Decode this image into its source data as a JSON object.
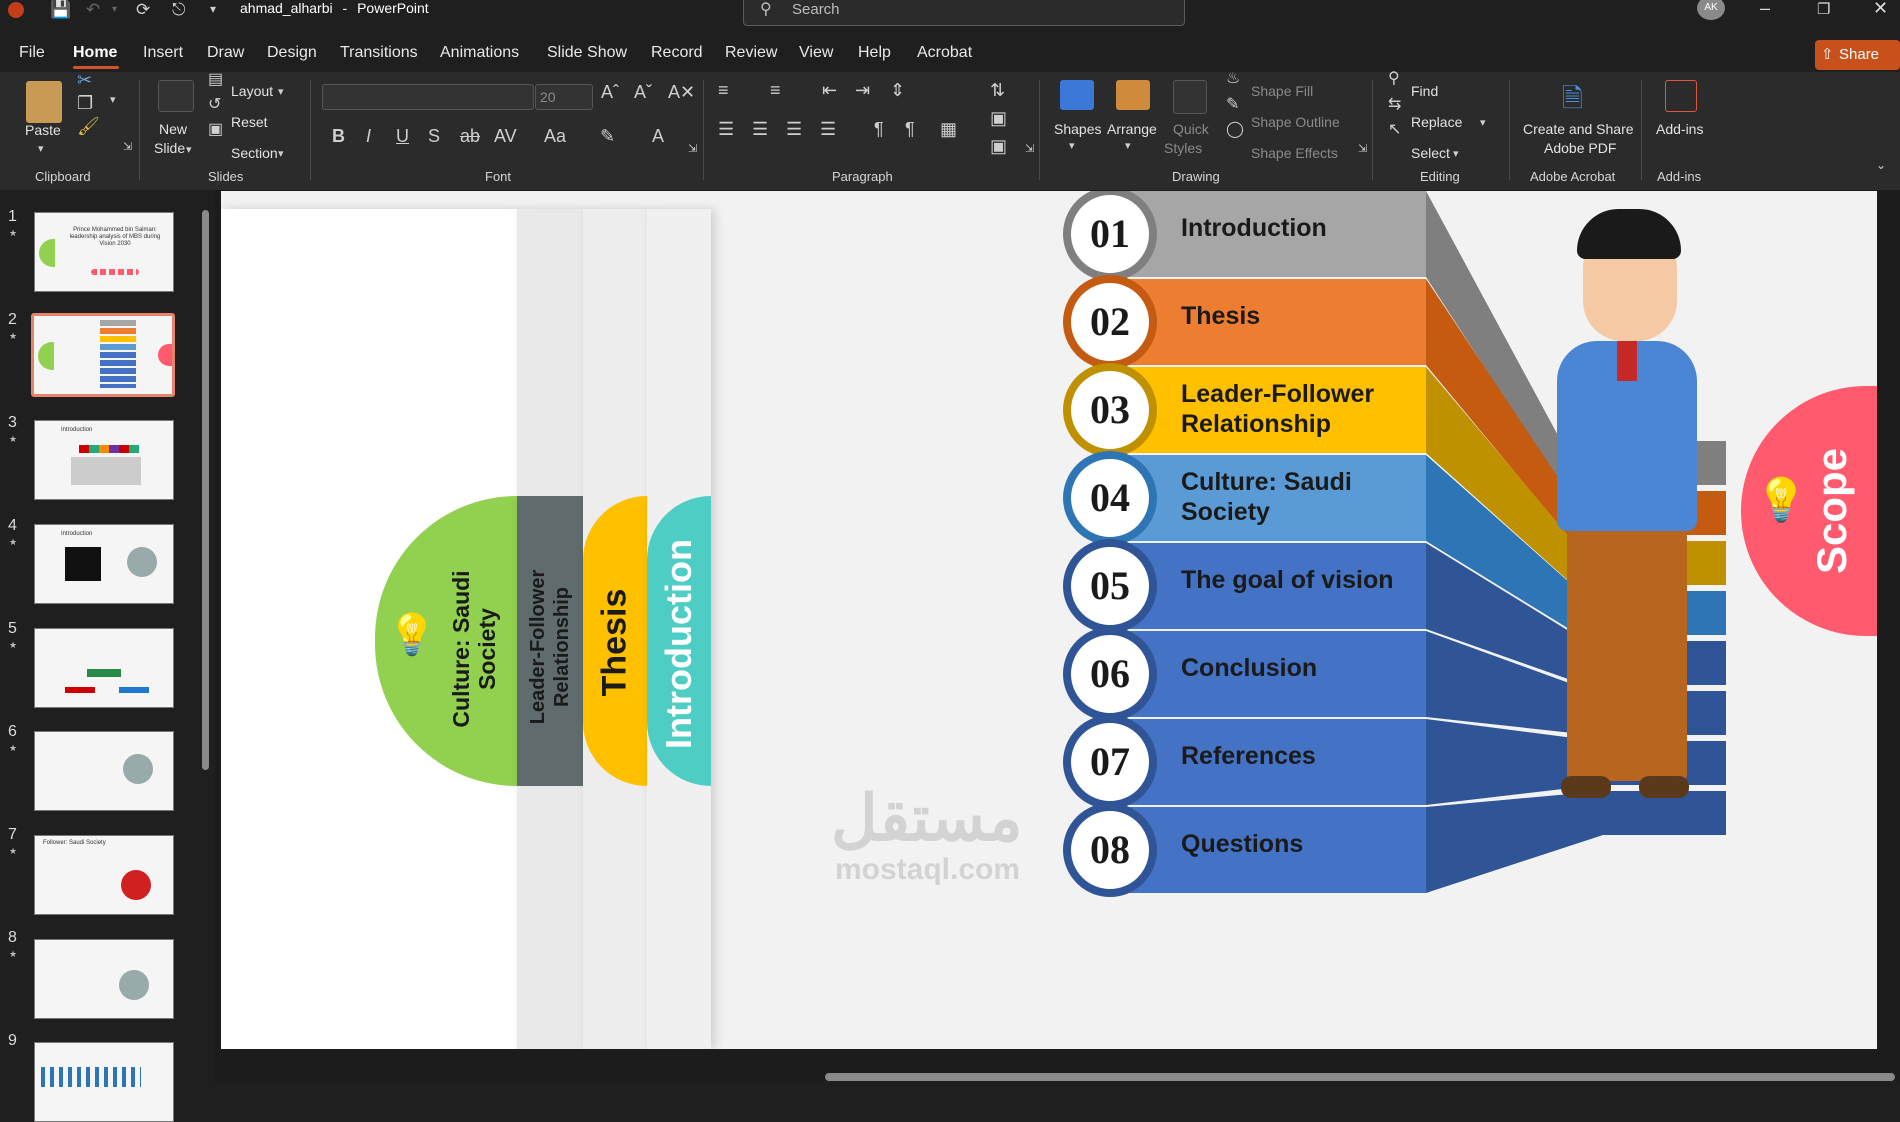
{
  "titlebar": {
    "file_name": "ahmad_alharbi",
    "separator": "-",
    "app_name": "PowerPoint",
    "search_placeholder": "Search",
    "avatar_initials": "AK"
  },
  "menu": {
    "items": [
      "File",
      "Home",
      "Insert",
      "Draw",
      "Design",
      "Transitions",
      "Animations",
      "Slide Show",
      "Record",
      "Review",
      "View",
      "Help",
      "Acrobat"
    ],
    "active": "Home",
    "share_label": "Share"
  },
  "ribbon": {
    "clipboard": {
      "paste": "Paste",
      "group": "Clipboard"
    },
    "slides": {
      "new_slide_1": "New",
      "new_slide_2": "Slide",
      "layout": "Layout",
      "reset": "Reset",
      "section": "Section",
      "group": "Slides"
    },
    "font": {
      "font_size": "20",
      "group": "Font"
    },
    "paragraph": {
      "group": "Paragraph"
    },
    "drawing": {
      "shapes": "Shapes",
      "arrange": "Arrange",
      "quick_styles_1": "Quick",
      "quick_styles_2": "Styles",
      "shape_fill": "Shape Fill",
      "shape_outline": "Shape Outline",
      "shape_effects": "Shape Effects",
      "group": "Drawing"
    },
    "editing": {
      "find": "Find",
      "replace": "Replace",
      "select": "Select",
      "group": "Editing"
    },
    "acrobat": {
      "create_1": "Create and Share",
      "create_2": "Adobe PDF",
      "group": "Adobe Acrobat"
    },
    "addins": {
      "label": "Add-ins",
      "group": "Add-ins"
    }
  },
  "thumbnails": {
    "numbers": [
      "1",
      "2",
      "3",
      "4",
      "5",
      "6",
      "7",
      "8",
      "9"
    ],
    "selected": "2",
    "title_1": "Prince Mohammed bin Salman: leadership analysis of MBS during Vision 2030",
    "title_3": "Introduction",
    "title_4": "Introduction",
    "title_7": "Follower: Saudi Society"
  },
  "slide": {
    "agenda": [
      {
        "num": "01",
        "label": "Introduction",
        "color": "#a6a6a6"
      },
      {
        "num": "02",
        "label": "Thesis",
        "color": "#ed7d31"
      },
      {
        "num": "03",
        "label": "Leader-Follower Relationship",
        "color": "#ffc000"
      },
      {
        "num": "04",
        "label": "Culture: Saudi Society",
        "color": "#5b9bd5"
      },
      {
        "num": "05",
        "label": "The goal of vision",
        "color": "#4472c4"
      },
      {
        "num": "06",
        "label": "Conclusion",
        "color": "#4472c4"
      },
      {
        "num": "07",
        "label": "References",
        "color": "#4472c4"
      },
      {
        "num": "08",
        "label": "Questions",
        "color": "#4472c4"
      }
    ],
    "side_tabs": [
      {
        "label": "Culture: Saudi Society",
        "color": "#92d050"
      },
      {
        "label": "Leader-Follower Relationship",
        "color": "#5f6b6d"
      },
      {
        "label": "Thesis",
        "color": "#ffc000"
      },
      {
        "label": "Introduction",
        "color": "#4ecdc4"
      }
    ],
    "scope_label": "Scope",
    "scope_color": "#ff5a6e",
    "watermark_arabic": "مستقل",
    "watermark_latin": "mostaql.com"
  }
}
